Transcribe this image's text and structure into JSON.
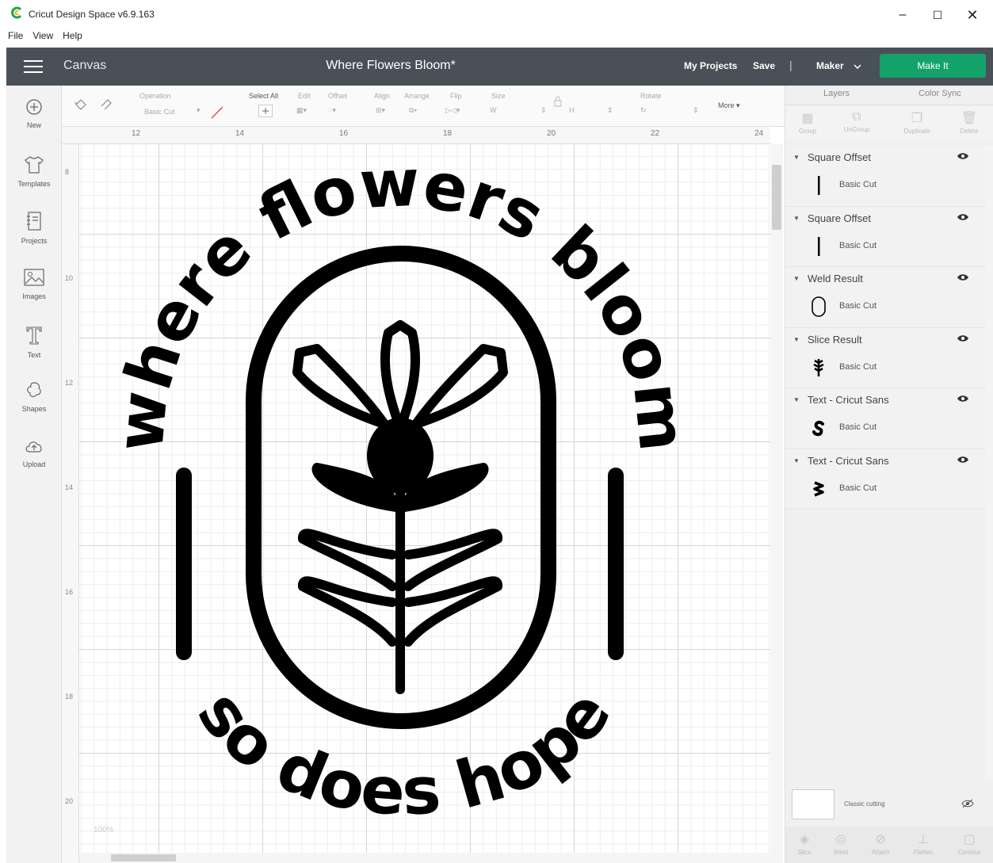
{
  "window": {
    "title": "Cricut Design Space  v6.9.163",
    "min": "–",
    "max": "☐",
    "close": "✕"
  },
  "menu": [
    "File",
    "View",
    "Help"
  ],
  "header": {
    "section": "Canvas",
    "document_title": "Where Flowers Bloom*",
    "my_projects": "My Projects",
    "save": "Save",
    "separator": "|",
    "machine": "Maker",
    "make_it": "Make It"
  },
  "sidebar": [
    {
      "label": "New",
      "icon": "plus-circle-icon"
    },
    {
      "label": "Templates",
      "icon": "tshirt-icon"
    },
    {
      "label": "Projects",
      "icon": "notebook-icon"
    },
    {
      "label": "Images",
      "icon": "image-icon"
    },
    {
      "label": "Text",
      "icon": "text-t-icon"
    },
    {
      "label": "Shapes",
      "icon": "shapes-icon"
    },
    {
      "label": "Upload",
      "icon": "cloud-upload-icon"
    }
  ],
  "toolbar": {
    "operation": "Operation",
    "operation_value": "Basic Cut",
    "select_all": "Select All",
    "edit": "Edit",
    "offset": "Offset",
    "align": "Align",
    "arrange": "Arrange",
    "flip": "Flip",
    "size": "Size",
    "rotate": "Rotate",
    "more": "More ▾"
  },
  "ruler": {
    "top": [
      "12",
      "14",
      "16",
      "18",
      "20",
      "22",
      "24"
    ],
    "left": [
      "8",
      "10",
      "12",
      "14",
      "16",
      "18",
      "20"
    ]
  },
  "artwork": {
    "top_text": "where flowers bloom",
    "bottom_text": "so does hope"
  },
  "zoom": "100%",
  "panel": {
    "tabs": [
      "Layers",
      "Color Sync"
    ],
    "actions": [
      "Group",
      "UnGroup",
      "Duplicate",
      "Delete"
    ],
    "layers": [
      {
        "name": "Square Offset",
        "operation": "Basic Cut",
        "thumb": "line"
      },
      {
        "name": "Square Offset",
        "operation": "Basic Cut",
        "thumb": "line"
      },
      {
        "name": "Weld Result",
        "operation": "Basic Cut",
        "thumb": "capsule"
      },
      {
        "name": "Slice Result",
        "operation": "Basic Cut",
        "thumb": "flower"
      },
      {
        "name": "Text - Cricut Sans",
        "operation": "Basic Cut",
        "thumb": "s-shape"
      },
      {
        "name": "Text - Cricut Sans",
        "operation": "Basic Cut",
        "thumb": "w-shape"
      }
    ],
    "blank_canvas": "Classic cutting",
    "bottom_actions": [
      "Slice",
      "Weld",
      "Attach",
      "Flatten",
      "Contour"
    ]
  }
}
